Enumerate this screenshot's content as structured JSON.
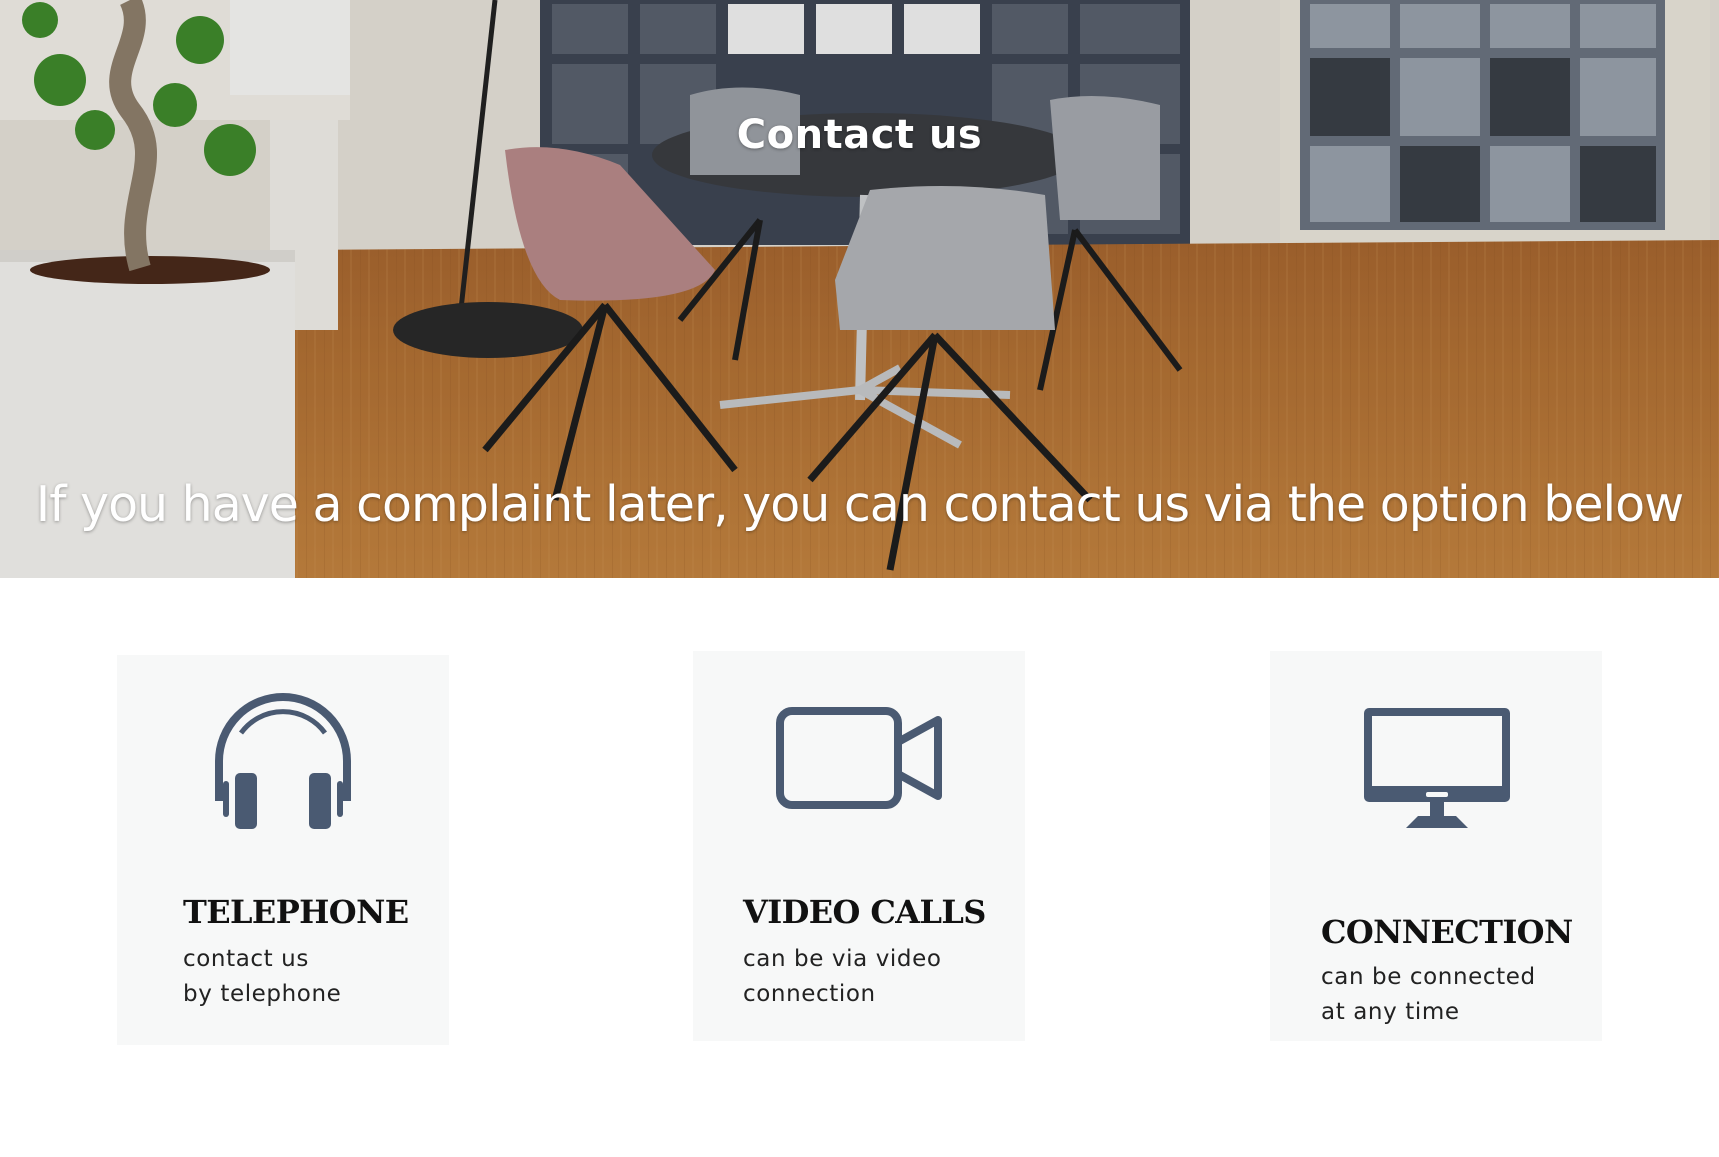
{
  "hero": {
    "title": "Contact us",
    "subtitle": "If you have a complaint later, you can contact us via the option below"
  },
  "theme": {
    "icon_color": "#4a5a72",
    "card_background": "#f7f8f8",
    "heading_color": "#111111"
  },
  "cards": [
    {
      "icon": "headphones-icon",
      "title": "TELEPHONE",
      "text_lines": [
        "contact us",
        "by telephone"
      ]
    },
    {
      "icon": "video-camera-icon",
      "title": "VIDEO CALLS",
      "text_lines": [
        "can be via video",
        "connection"
      ]
    },
    {
      "icon": "monitor-icon",
      "title": "CONNECTION",
      "text_lines": [
        "can be connected",
        "at any time"
      ]
    }
  ]
}
